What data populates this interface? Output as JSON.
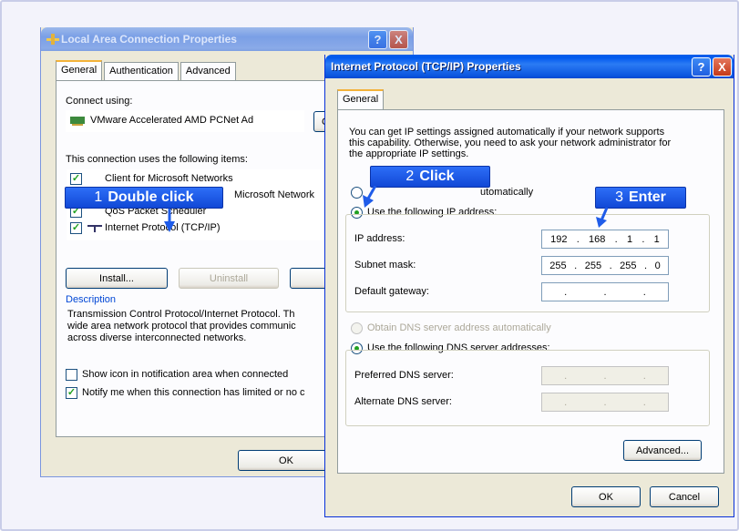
{
  "lan_dialog": {
    "title": "Local Area Connection Properties",
    "help_btn": "?",
    "close_btn": "X",
    "tabs": [
      "General",
      "Authentication",
      "Advanced"
    ],
    "connect_using_label": "Connect using:",
    "adapter_name": "VMware Accelerated AMD PCNet Ad",
    "configure_btn_partial": "C",
    "items_label": "This connection uses the following items:",
    "items": [
      "Client for Microsoft Networks",
      "Microsoft Network",
      "QoS Packet Scheduler",
      "Internet Protocol (TCP/IP)"
    ],
    "install_btn": "Install...",
    "uninstall_btn": "Uninstall",
    "properties_btn_partial": "P",
    "description_label": "Description",
    "description_lines": [
      "Transmission Control Protocol/Internet Protocol. Th",
      "wide area network protocol that provides communic",
      "across diverse interconnected networks."
    ],
    "show_icon_label": "Show icon in notification area when connected",
    "notify_label": "Notify me when this connection has limited or no c",
    "ok_btn": "OK"
  },
  "tcpip_dialog": {
    "title": "Internet Protocol (TCP/IP) Properties",
    "help_btn": "?",
    "close_btn": "X",
    "tab": "General",
    "intro_lines": [
      "You can get IP settings assigned automatically if your network supports",
      "this capability. Otherwise, you need to ask your network administrator for",
      "the appropriate IP settings."
    ],
    "auto_ip_label_partial": "utomatically",
    "use_ip_label": "Use the following IP address:",
    "ip_address_label": "IP address:",
    "ip_address_value": [
      "192",
      "168",
      "1",
      "1"
    ],
    "subnet_label": "Subnet mask:",
    "subnet_value": [
      "255",
      "255",
      "255",
      "0"
    ],
    "gateway_label": "Default gateway:",
    "auto_dns_label": "Obtain DNS server address automatically",
    "use_dns_label": "Use the following DNS server addresses:",
    "preferred_dns_label": "Preferred DNS server:",
    "alternate_dns_label": "Alternate DNS server:",
    "advanced_btn": "Advanced...",
    "ok_btn": "OK",
    "cancel_btn": "Cancel"
  },
  "callouts": {
    "step1_num": "1",
    "step1_text": "Double click",
    "step2_num": "2",
    "step2_text": "Click",
    "step3_num": "3",
    "step3_text": "Enter"
  },
  "colors": {
    "callout_blue": "#1f5ce9",
    "titlebar_active": "#0058ee",
    "checked_green": "#21a121"
  }
}
